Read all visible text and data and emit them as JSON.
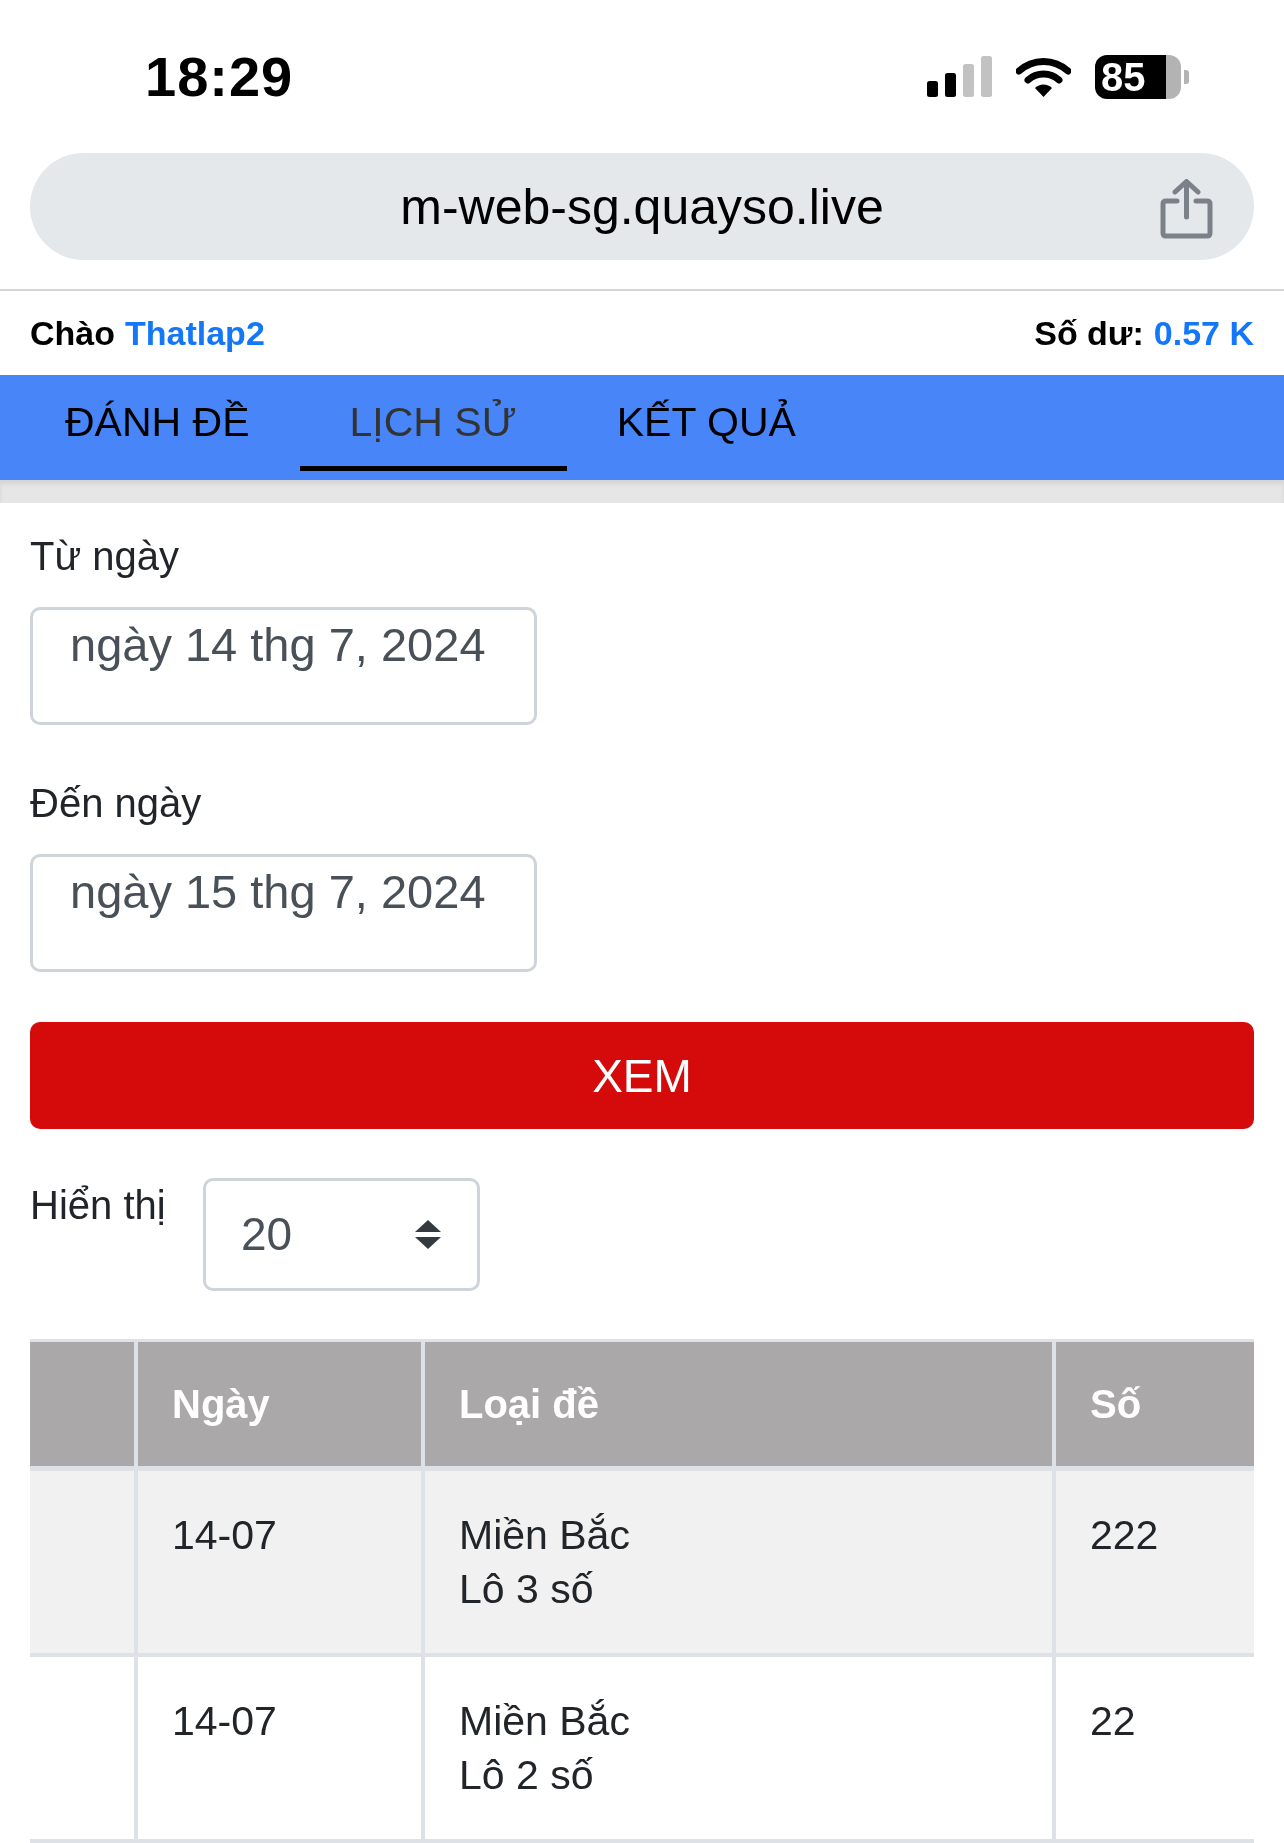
{
  "status_bar": {
    "time": "18:29",
    "battery": "85"
  },
  "address_bar": {
    "url": "m-web-sg.quayso.live"
  },
  "header": {
    "greeting": "Chào",
    "username": "Thatlap2",
    "balance_label": "Số dư:",
    "balance": "0.57 K"
  },
  "tabs": [
    {
      "label": "ĐÁNH ĐỀ",
      "selected": false
    },
    {
      "label": "LỊCH SỬ",
      "selected": true
    },
    {
      "label": "KẾT QUẢ",
      "selected": false
    }
  ],
  "filters": {
    "from": {
      "label": "Từ ngày",
      "value": "ngày 14 thg 7, 2024"
    },
    "to": {
      "label": "Đến ngày",
      "value": "ngày 15 thg 7, 2024"
    },
    "submit": "XEM",
    "page_size": {
      "label": "Hiển thị",
      "value": "20"
    }
  },
  "table": {
    "columns": [
      "Ngày",
      "Loại đề",
      "Số"
    ],
    "rows": [
      {
        "date": "14-07",
        "region": "Miền Bắc",
        "bet_type": "Lô 3 số",
        "number": "222"
      },
      {
        "date": "14-07",
        "region": "Miền Bắc",
        "bet_type": "Lô 2 số",
        "number": "22"
      }
    ]
  }
}
